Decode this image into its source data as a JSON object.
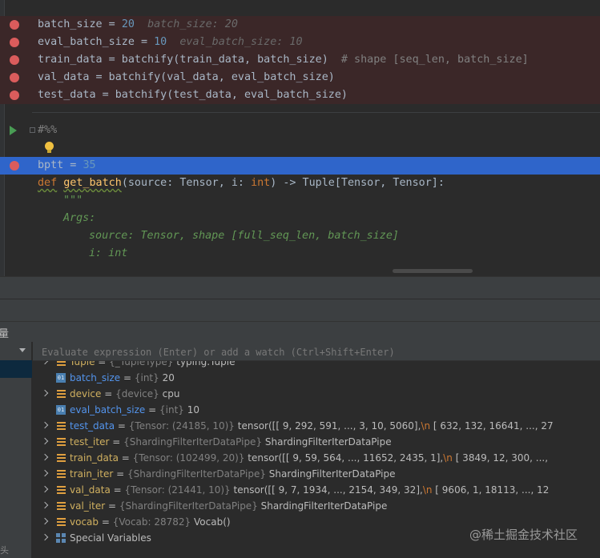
{
  "editor": {
    "lines": {
      "l1": {
        "code": "batch_size = ",
        "num": "20",
        "inline": "batch_size: 20"
      },
      "l2": {
        "code": "eval_batch_size = ",
        "num": "10",
        "inline": "eval_batch_size: 10"
      },
      "l3": {
        "code_a": "train_data = batchify(train_data, batch_size)",
        "comment": "# shape [seq_len, batch_size]"
      },
      "l4": {
        "code": "val_data = batchify(val_data, eval_batch_size)"
      },
      "l5": {
        "code": "test_data = batchify(test_data, eval_batch_size)"
      },
      "l6": {
        "cell": "#%%"
      },
      "l8": {
        "code": "bptt = ",
        "num": "35"
      },
      "l9": {
        "kw": "def",
        "fn": "get_batch",
        "args_a": "(source: Tensor, i: ",
        "int": "int",
        "args_b": ") -> Tuple[Tensor, Tensor]:"
      },
      "l10": {
        "doc": "\"\"\""
      },
      "l11": {
        "doc": "Args:"
      },
      "l12": {
        "doc": "source: Tensor, shape [full_seq_len, batch_size]"
      },
      "l13": {
        "doc": "i: int"
      }
    }
  },
  "panel": {
    "title_fragment": "量",
    "watch_placeholder": "Evaluate expression (Enter) or add a watch (Ctrl+Shift+Enter)"
  },
  "variables": [
    {
      "name": "Tuple",
      "type": "{_TupleType}",
      "value": "typing.Tuple",
      "expandable": true
    },
    {
      "name": "batch_size",
      "type": "{int}",
      "value": "20",
      "expandable": false
    },
    {
      "name": "device",
      "type": "{device}",
      "value": "cpu",
      "expandable": true
    },
    {
      "name": "eval_batch_size",
      "type": "{int}",
      "value": "10",
      "expandable": false
    },
    {
      "name": "test_data",
      "type": "{Tensor: (24185, 10)}",
      "value_a": "tensor([[    9,   292,   591,  ...,     3,    10,  5060],",
      "value_b": "        [  632,   132, 16641,  ...,   27",
      "expandable": true
    },
    {
      "name": "test_iter",
      "type": "{ShardingFilterIterDataPipe}",
      "value": "ShardingFilterIterDataPipe",
      "expandable": true
    },
    {
      "name": "train_data",
      "type": "{Tensor: (102499, 20)}",
      "value_a": "tensor([[    9,    59,   564,  ..., 11652,  2435,     1],",
      "value_b": "        [ 3849,    12,   300,  ...,",
      "expandable": true
    },
    {
      "name": "train_iter",
      "type": "{ShardingFilterIterDataPipe}",
      "value": "ShardingFilterIterDataPipe",
      "expandable": true
    },
    {
      "name": "val_data",
      "type": "{Tensor: (21441, 10)}",
      "value_a": "tensor([[    9,     7,  1934,  ...,  2154,   349,    32],",
      "value_b": "        [ 9606,     1, 18113,  ...,   12",
      "expandable": true
    },
    {
      "name": "val_iter",
      "type": "{ShardingFilterIterDataPipe}",
      "value": "ShardingFilterIterDataPipe",
      "expandable": true
    },
    {
      "name": "vocab",
      "type": "{Vocab: 28782}",
      "value": "Vocab()",
      "expandable": true
    },
    {
      "name": "Special Variables",
      "expandable": true
    }
  ],
  "newline_marker": "\\n",
  "watermark": "@稀土掘金技术社区",
  "bottom_text": "头"
}
